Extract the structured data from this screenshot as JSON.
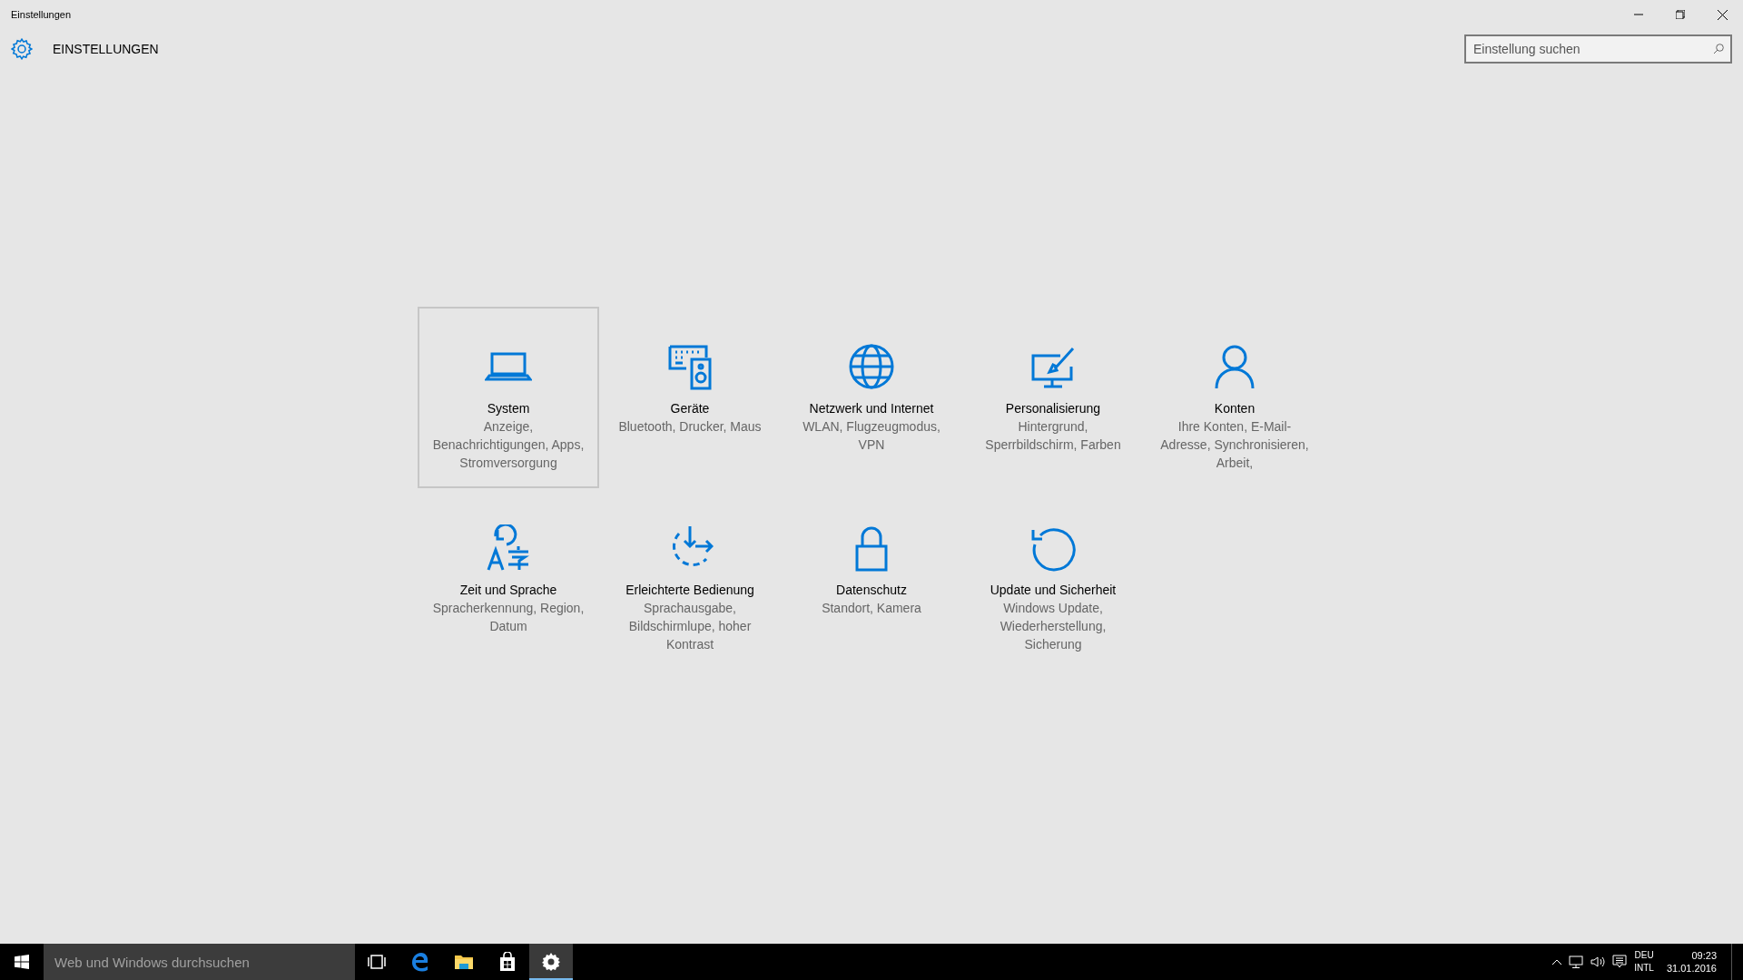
{
  "window": {
    "title": "Einstellungen"
  },
  "header": {
    "title": "EINSTELLUNGEN"
  },
  "search": {
    "placeholder": "Einstellung suchen"
  },
  "tiles": [
    {
      "kind": "system",
      "title": "System",
      "description": "Anzeige, Benachrichtigungen, Apps, Stromversorgung",
      "selected": true
    },
    {
      "kind": "devices",
      "title": "Geräte",
      "description": "Bluetooth, Drucker, Maus",
      "selected": false
    },
    {
      "kind": "network",
      "title": "Netzwerk und Internet",
      "description": "WLAN, Flugzeugmodus, VPN",
      "selected": false
    },
    {
      "kind": "personalization",
      "title": "Personalisierung",
      "description": "Hintergrund, Sperrbildschirm, Farben",
      "selected": false
    },
    {
      "kind": "accounts",
      "title": "Konten",
      "description": "Ihre Konten, E-Mail-Adresse, Synchronisieren, Arbeit,",
      "selected": false
    },
    {
      "kind": "time",
      "title": "Zeit und Sprache",
      "description": "Spracherkennung, Region, Datum",
      "selected": false
    },
    {
      "kind": "ease",
      "title": "Erleichterte Bedienung",
      "description": "Sprachausgabe, Bildschirmlupe, hoher Kontrast",
      "selected": false
    },
    {
      "kind": "privacy",
      "title": "Datenschutz",
      "description": "Standort, Kamera",
      "selected": false
    },
    {
      "kind": "update",
      "title": "Update und Sicherheit",
      "description": "Windows Update, Wiederherstellung, Sicherung",
      "selected": false
    }
  ],
  "taskbar": {
    "search_placeholder": "Web und Windows durchsuchen",
    "apps": [
      {
        "kind": "taskview",
        "active": false
      },
      {
        "kind": "edge",
        "active": false
      },
      {
        "kind": "explorer",
        "active": false
      },
      {
        "kind": "store",
        "active": false
      },
      {
        "kind": "settings",
        "active": true
      }
    ],
    "language": [
      "DEU",
      "INTL"
    ],
    "time": "09:23",
    "date": "31.01.2016"
  }
}
